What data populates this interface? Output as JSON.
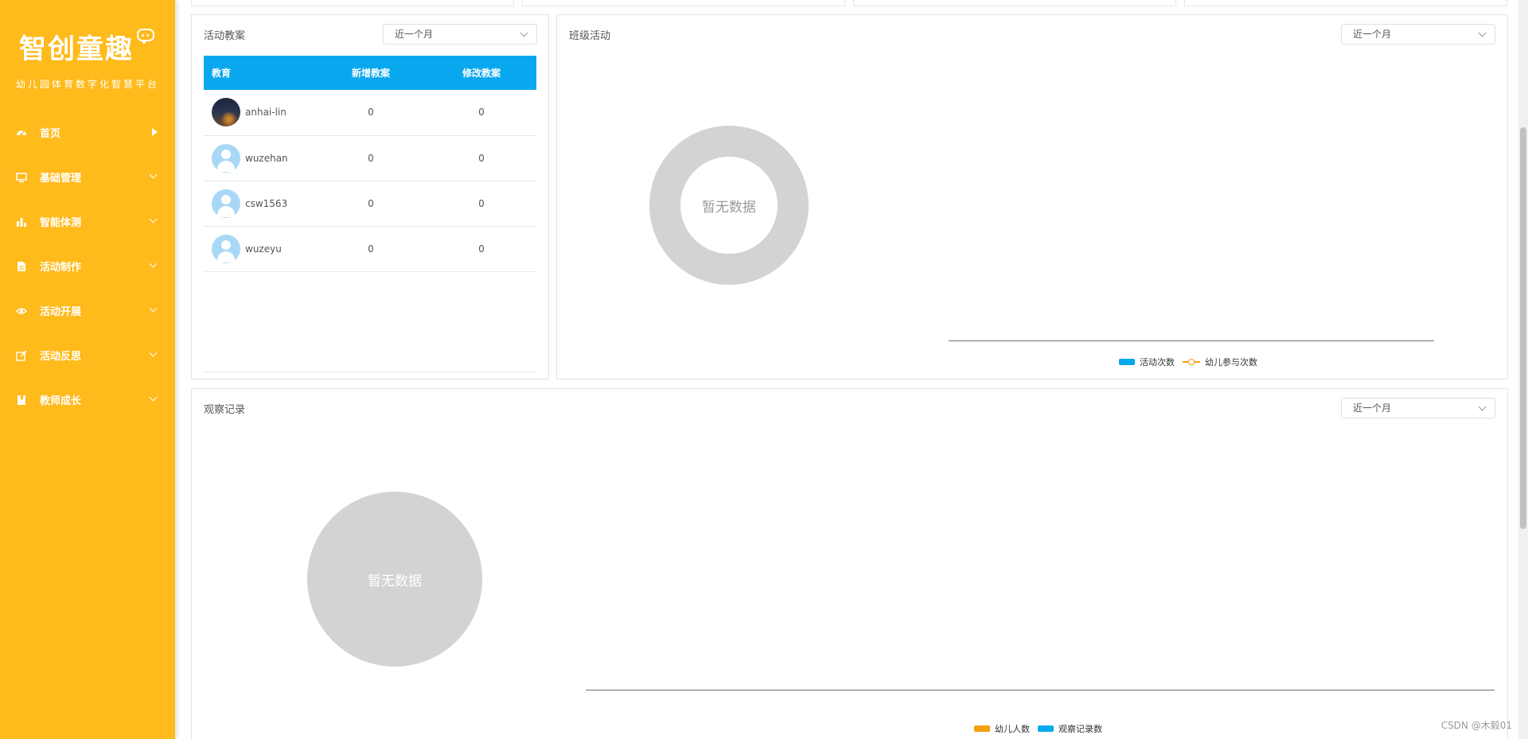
{
  "sidebar": {
    "logo": "智创童趣",
    "subtitle": "幼儿园体育数字化智慧平台",
    "items": [
      {
        "label": "首页",
        "icon": "dashboard-icon"
      },
      {
        "label": "基础管理",
        "icon": "monitor-icon"
      },
      {
        "label": "智能体测",
        "icon": "bar-chart-icon"
      },
      {
        "label": "活动制作",
        "icon": "document-icon"
      },
      {
        "label": "活动开展",
        "icon": "eye-icon"
      },
      {
        "label": "活动反思",
        "icon": "edit-icon"
      },
      {
        "label": "教师成长",
        "icon": "bookmark-icon"
      }
    ]
  },
  "plans": {
    "title": "活动教案",
    "filter": "近一个月",
    "columns": [
      "教育",
      "新增教案",
      "修改教案"
    ],
    "rows": [
      {
        "name": "anhai-lin",
        "added": "0",
        "modified": "0"
      },
      {
        "name": "wuzehan",
        "added": "0",
        "modified": "0"
      },
      {
        "name": "csw1563",
        "added": "0",
        "modified": "0"
      },
      {
        "name": "wuzeyu",
        "added": "0",
        "modified": "0"
      }
    ]
  },
  "class_activity": {
    "title": "班级活动",
    "filter": "近一个月",
    "nodata": "暂无数据",
    "legend": [
      "活动次数",
      "幼儿参与次数"
    ]
  },
  "observation": {
    "title": "观察记录",
    "filter": "近一个月",
    "nodata": "暂无数据",
    "legend": [
      "幼儿人数",
      "观察记录数"
    ]
  },
  "colors": {
    "sidebar": "#FFBA1B",
    "table_header": "#09A8EE",
    "series_blue": "#09A8EE",
    "series_orange": "#F7A00E"
  },
  "watermark": "CSDN @木毅01"
}
